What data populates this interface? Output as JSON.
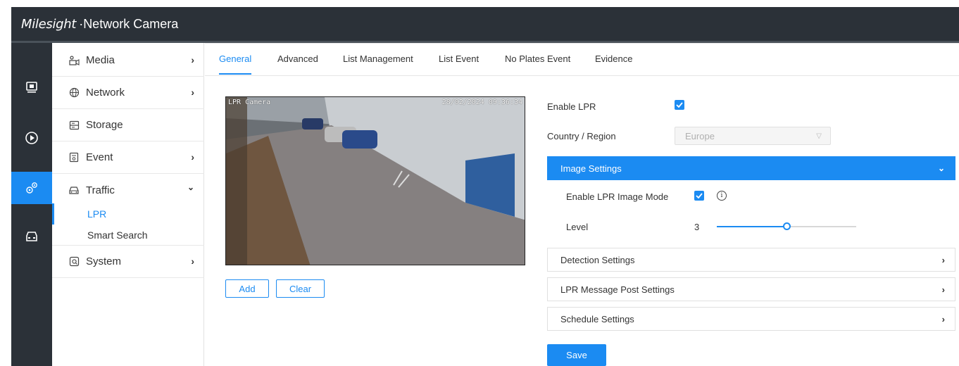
{
  "app": {
    "brand": "Milesight",
    "title": "Network Camera"
  },
  "iconbar": [
    {
      "icon": "live-view-icon"
    },
    {
      "icon": "playback-icon"
    },
    {
      "icon": "settings-icon",
      "active": true
    },
    {
      "icon": "vehicle-icon"
    }
  ],
  "sidebar": {
    "items": [
      {
        "label": "Media",
        "icon": "media-icon",
        "has_children": true
      },
      {
        "label": "Network",
        "icon": "globe-icon",
        "has_children": true
      },
      {
        "label": "Storage",
        "icon": "storage-icon",
        "has_children": false
      },
      {
        "label": "Event",
        "icon": "event-icon",
        "has_children": true
      },
      {
        "label": "Traffic",
        "icon": "car-icon",
        "expanded": true
      },
      {
        "label": "System",
        "icon": "system-icon",
        "has_children": true
      }
    ],
    "traffic_sub": [
      {
        "label": "LPR",
        "active": true
      },
      {
        "label": "Smart Search"
      }
    ]
  },
  "tabs": [
    {
      "label": "General",
      "active": true
    },
    {
      "label": "Advanced"
    },
    {
      "label": "List Management"
    },
    {
      "label": "List Event"
    },
    {
      "label": "No Plates Event"
    },
    {
      "label": "Evidence"
    }
  ],
  "camera": {
    "osd_name": "LPR Camera",
    "osd_time": "28/02/2024 09:36:34"
  },
  "actions": {
    "add": "Add",
    "clear": "Clear",
    "save": "Save"
  },
  "form": {
    "enable_lpr_label": "Enable LPR",
    "enable_lpr": true,
    "country_label": "Country / Region",
    "country_value": "Europe"
  },
  "sections": {
    "image_settings": "Image Settings",
    "detection_settings": "Detection Settings",
    "lpr_message_post": "LPR Message Post Settings",
    "schedule_settings": "Schedule Settings"
  },
  "image_settings": {
    "enable_mode_label": "Enable LPR Image Mode",
    "enable_mode": true,
    "level_label": "Level",
    "level_value": "3",
    "level_fraction": 0.5
  },
  "colors": {
    "accent": "#1b8bf2",
    "topbar": "#2b3138"
  }
}
